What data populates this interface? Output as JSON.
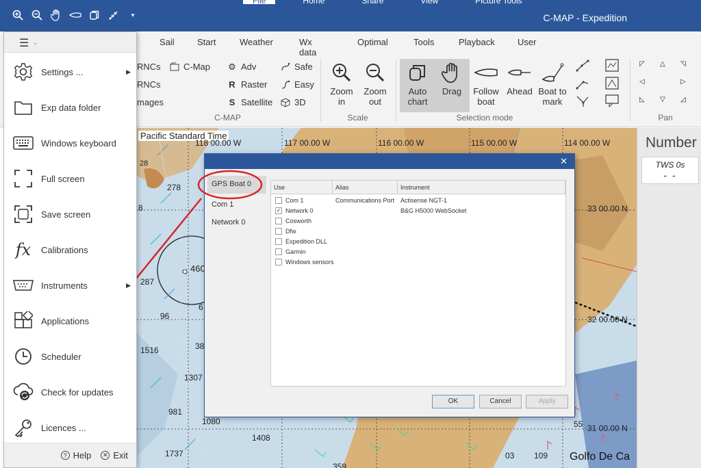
{
  "title_bar": {
    "app_title": "C-MAP - Expedition",
    "menu_tabs": [
      "File",
      "Home",
      "Share",
      "View",
      "Picture Tools"
    ]
  },
  "ribbon": {
    "tabs": [
      "Sail",
      "Start",
      "Weather",
      "Wx data",
      "Optimal",
      "Tools",
      "Playback",
      "User"
    ],
    "cmap_group": {
      "label": "C-MAP",
      "left_partial": [
        "RNCs",
        "RNCs",
        "mages"
      ],
      "items": [
        "C-Map",
        "Adv",
        "Safe",
        "Raster",
        "Easy",
        "Satellite",
        "3D"
      ]
    },
    "scale_group": {
      "label": "Scale",
      "zoom_in": [
        "Zoom",
        "in"
      ],
      "zoom_out": [
        "Zoom",
        "out"
      ]
    },
    "selection_group": {
      "label": "Selection mode",
      "auto_chart": [
        "Auto",
        "chart"
      ],
      "drag": "Drag",
      "follow_boat": [
        "Follow",
        "boat"
      ],
      "ahead": "Ahead",
      "boat_to_mark": [
        "Boat to",
        "mark"
      ]
    },
    "pan_group": {
      "label": "Pan"
    }
  },
  "map": {
    "timezone": "Pacific Standard Time",
    "longitudes": [
      "118 00.00 W",
      "117 00.00 W",
      "116 00.00 W",
      "115 00.00 W",
      "114 00.00 W"
    ],
    "latitudes": [
      "33 00.00 N",
      "32 00.00 N",
      "31 00.00 N"
    ],
    "depths": [
      "278",
      "287",
      "96",
      "1516",
      "1307",
      "981",
      "1080",
      "1408",
      "1737",
      "38",
      "460",
      "6",
      "359",
      "28",
      "55",
      "109",
      "03",
      "8"
    ],
    "place": "Golfo De Ca"
  },
  "right_panel": {
    "title": "Number",
    "tws_label": "TWS 0s",
    "tws_value": "- -"
  },
  "side_menu": {
    "items": [
      {
        "label": "Settings ...",
        "icon": "gear-icon",
        "arrow": true
      },
      {
        "label": "Exp data folder",
        "icon": "folder-icon",
        "arrow": false
      },
      {
        "label": "Windows keyboard",
        "icon": "keyboard-icon",
        "arrow": false
      },
      {
        "label": "Full screen",
        "icon": "fullscreen-icon",
        "arrow": false
      },
      {
        "label": "Save screen",
        "icon": "save-screen-icon",
        "arrow": false
      },
      {
        "label": "Calibrations",
        "icon": "fx-icon",
        "arrow": false
      },
      {
        "label": "Instruments",
        "icon": "instruments-icon",
        "arrow": true
      },
      {
        "label": "Applications",
        "icon": "applications-icon",
        "arrow": false
      },
      {
        "label": "Scheduler",
        "icon": "clock-icon",
        "arrow": false
      },
      {
        "label": "Check for updates",
        "icon": "cloud-update-icon",
        "arrow": false
      },
      {
        "label": "Licences ...",
        "icon": "key-icon",
        "arrow": false
      }
    ],
    "help": "Help",
    "exit": "Exit"
  },
  "dialog": {
    "list": [
      "GPS Boat 0",
      "Com 1",
      "Network 0"
    ],
    "columns": [
      "Use",
      "Alias",
      "Instrument"
    ],
    "rows": [
      {
        "use": "Com 1",
        "checked": false,
        "alias": "Communications Port",
        "instrument": "Actisense NGT-1"
      },
      {
        "use": "Network 0",
        "checked": true,
        "alias": "",
        "instrument": "B&G H5000 WebSocket"
      },
      {
        "use": "Cosworth",
        "checked": false,
        "alias": "",
        "instrument": ""
      },
      {
        "use": "Dfw",
        "checked": false,
        "alias": "",
        "instrument": ""
      },
      {
        "use": "Expedition DLL",
        "checked": false,
        "alias": "",
        "instrument": ""
      },
      {
        "use": "Garmin",
        "checked": false,
        "alias": "",
        "instrument": ""
      },
      {
        "use": "Windows sensors",
        "checked": false,
        "alias": "",
        "instrument": ""
      }
    ],
    "ok": "OK",
    "cancel": "Cancel",
    "apply": "Apply"
  },
  "colors": {
    "title_bar": "#2b579a",
    "annotation_red": "#d9252a",
    "land": "#d9b27a",
    "sea": "#c9dcea"
  }
}
